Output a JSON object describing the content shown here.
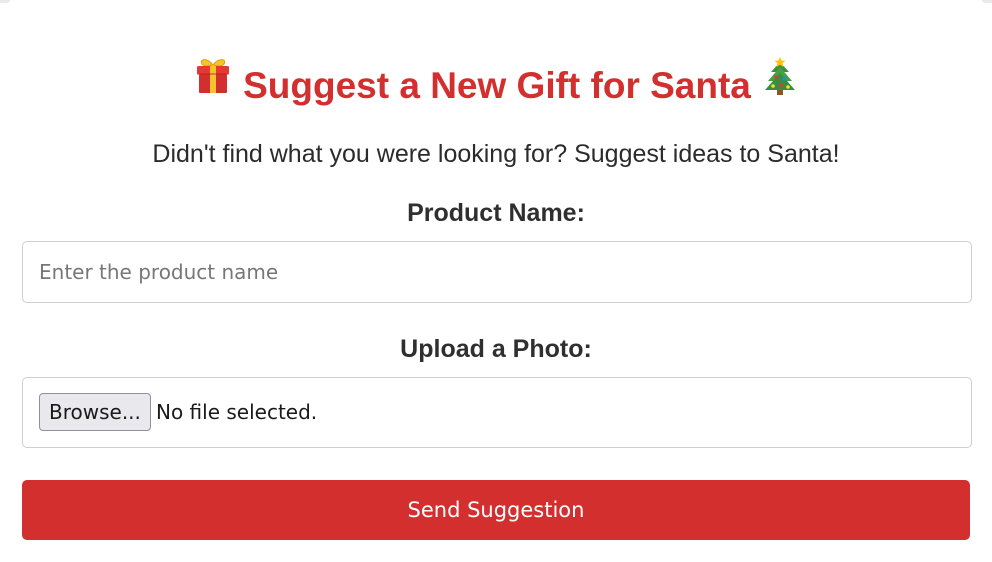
{
  "header": {
    "title": "Suggest a New Gift for Santa",
    "subtitle": "Didn't find what you were looking for? Suggest ideas to Santa!",
    "title_color": "#d32f2f",
    "left_icon": "gift-icon",
    "right_icon": "christmas-tree-icon"
  },
  "form": {
    "product_label": "Product Name:",
    "product_placeholder": "Enter the product name",
    "product_value": "",
    "photo_label": "Upload a Photo:",
    "browse_label": "Browse...",
    "file_status": "No file selected.",
    "submit_label": "Send Suggestion",
    "submit_color": "#d32f2f"
  }
}
